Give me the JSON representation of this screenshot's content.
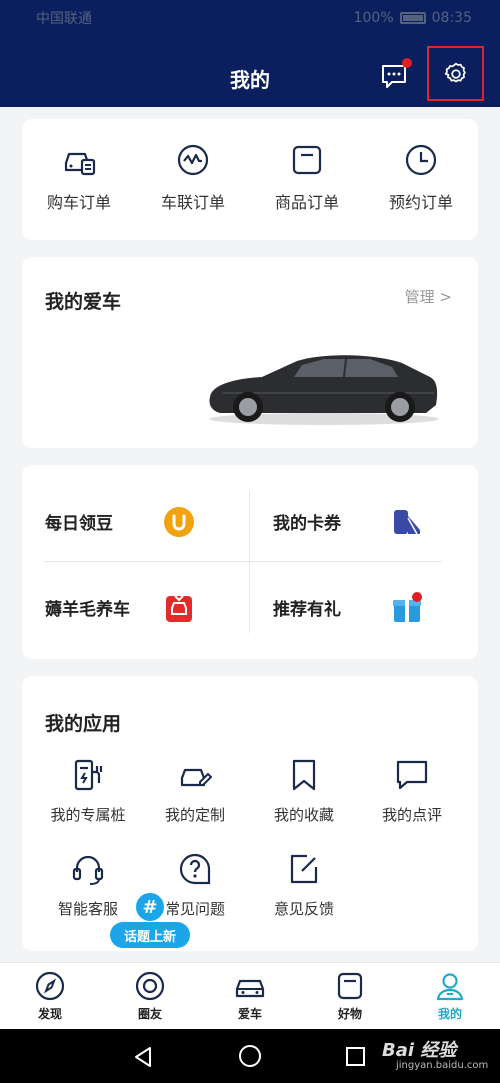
{
  "status": {
    "carrier": "中国联通",
    "battery": "100%",
    "time": "08:35"
  },
  "header": {
    "title": "我的"
  },
  "orders": [
    {
      "label": "购车订单",
      "icon": "car-order-icon"
    },
    {
      "label": "车联订单",
      "icon": "connected-car-icon"
    },
    {
      "label": "商品订单",
      "icon": "bag-icon"
    },
    {
      "label": "预约订单",
      "icon": "clock-icon"
    }
  ],
  "mycar": {
    "title": "我的爱车",
    "manage": "管理 >"
  },
  "perks": {
    "daily": "每日领豆",
    "coupons": "我的卡券",
    "wool": "薅羊毛养车",
    "referral": "推荐有礼"
  },
  "apps": {
    "title": "我的应用",
    "items": [
      {
        "label": "我的专属桩",
        "icon": "charger-icon"
      },
      {
        "label": "我的定制",
        "icon": "custom-car-icon"
      },
      {
        "label": "我的收藏",
        "icon": "bookmark-icon"
      },
      {
        "label": "我的点评",
        "icon": "comment-icon"
      },
      {
        "label": "智能客服",
        "icon": "headset-icon"
      },
      {
        "label": "常见问题",
        "icon": "question-icon"
      },
      {
        "label": "意见反馈",
        "icon": "feedback-icon"
      }
    ]
  },
  "topic": {
    "symbol": "#",
    "label": "话题上新"
  },
  "tabs": [
    {
      "label": "发现",
      "icon": "compass-icon"
    },
    {
      "label": "圈友",
      "icon": "circle-icon"
    },
    {
      "label": "爱车",
      "icon": "car-icon"
    },
    {
      "label": "好物",
      "icon": "shop-icon"
    },
    {
      "label": "我的",
      "icon": "user-icon"
    }
  ],
  "watermark": {
    "brand": "Bai 经验",
    "url": "jingyan.baidu.com"
  },
  "colors": {
    "header": "#0b1f5e",
    "accent": "#21a9c9",
    "highlight": "#e0262d"
  }
}
